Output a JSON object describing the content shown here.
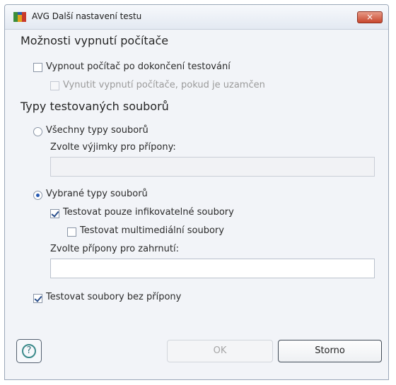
{
  "window": {
    "title": "AVG Další nastavení testu",
    "close_icon": "×"
  },
  "section_shutdown": {
    "heading": "Možnosti vypnutí počítače",
    "shutdown_after": {
      "label": "Vypnout počítač po dokončení testování",
      "checked": false
    },
    "force_shutdown": {
      "label": "Vynutit vypnutí počítače, pokud je uzamčen",
      "checked": false,
      "enabled": false
    }
  },
  "section_filetypes": {
    "heading": "Typy testovaných souborů",
    "all_types": {
      "label": "Všechny typy souborů",
      "selected": false
    },
    "exclusions_label": "Zvolte výjimky pro přípony:",
    "exclusions_value": "",
    "selected_types": {
      "label": "Vybrané typy souborů",
      "selected": true
    },
    "infectable_only": {
      "label": "Testovat pouze infikovatelné soubory",
      "checked": true
    },
    "multimedia": {
      "label": "Testovat multimediální soubory",
      "checked": false
    },
    "inclusions_label": "Zvolte přípony pro zahrnutí:",
    "inclusions_value": "",
    "no_extension": {
      "label": "Testovat soubory bez přípony",
      "checked": true
    }
  },
  "footer": {
    "help_icon": "?",
    "ok_label": "OK",
    "cancel_label": "Storno"
  },
  "colors": {
    "accent": "#2458b3",
    "close_button": "#c8472e"
  }
}
